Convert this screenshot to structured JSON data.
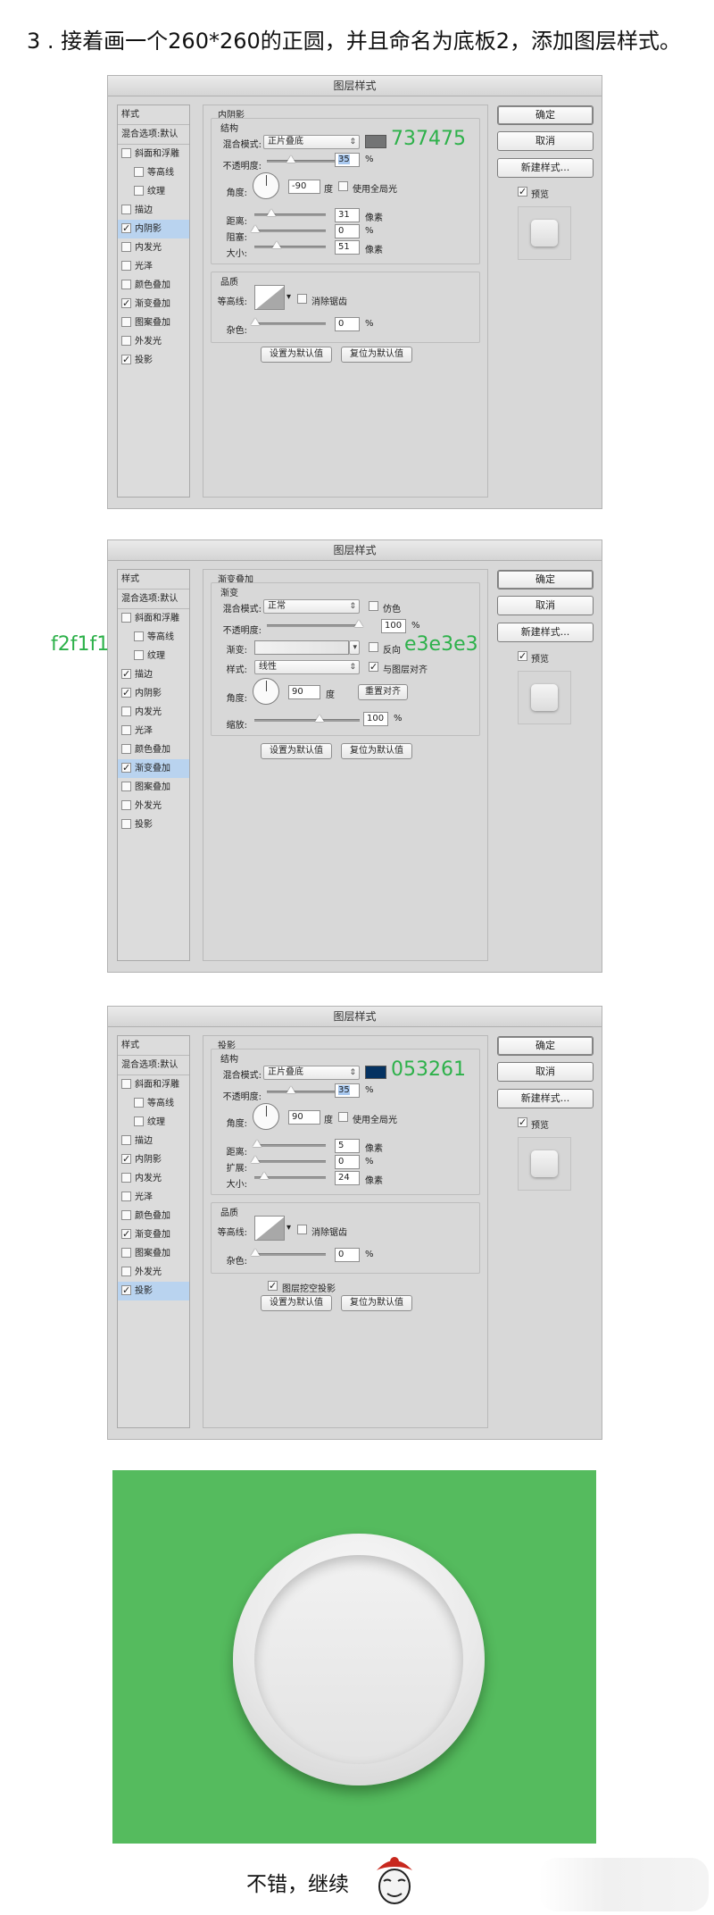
{
  "heading": "3 . 接着画一个260*260的正圆，并且命名为底板2，添加图层样式。",
  "colors": {
    "shadow_inner": "#737475",
    "shadow_drop": "#053261",
    "annotation": "#2db14a",
    "background_green": "#55bb5e"
  },
  "common": {
    "title": "图层样式",
    "left_head": "样式",
    "blend_default": "混合选项:默认",
    "left_items": [
      "斜面和浮雕",
      "等高线",
      "纹理",
      "描边",
      "内阴影",
      "内发光",
      "光泽",
      "颜色叠加",
      "渐变叠加",
      "图案叠加",
      "外发光",
      "投影"
    ],
    "ok": "确定",
    "cancel": "取消",
    "new_style": "新建样式...",
    "preview": "预览",
    "set_default": "设置为默认值",
    "reset_default": "复位为默认值"
  },
  "dialog1": {
    "section": "内阴影",
    "structure": "结构",
    "blend_mode_label": "混合模式:",
    "blend_mode": "正片叠底",
    "color_annotation": "737475",
    "opacity_label": "不透明度:",
    "opacity": "35",
    "percent": "%",
    "angle_label": "角度:",
    "angle": "-90",
    "degree": "度",
    "global_light": "使用全局光",
    "distance_label": "距离:",
    "distance": "31",
    "pixel": "像素",
    "choke_label": "阻塞:",
    "choke": "0",
    "size_label": "大小:",
    "size": "51",
    "quality": "品质",
    "contour_label": "等高线:",
    "antialias": "消除锯齿",
    "noise_label": "杂色:",
    "noise": "0"
  },
  "dialog2": {
    "section": "渐变叠加",
    "gradient_group": "渐变",
    "blend_mode_label": "混合模式:",
    "blend_mode": "正常",
    "dither": "仿色",
    "opacity_label": "不透明度:",
    "opacity": "100",
    "percent": "%",
    "gradient_label": "渐变:",
    "reverse": "反向",
    "style_label": "样式:",
    "style": "线性",
    "align_layer": "与图层对齐",
    "angle_label": "角度:",
    "angle": "90",
    "degree": "度",
    "reset_align": "重置对齐",
    "scale_label": "缩放:",
    "scale": "100",
    "anno_left": "f2f1f1",
    "anno_right": "e3e3e3"
  },
  "dialog3": {
    "section": "投影",
    "structure": "结构",
    "blend_mode_label": "混合模式:",
    "blend_mode": "正片叠底",
    "color_annotation": "053261",
    "opacity_label": "不透明度:",
    "opacity": "35",
    "percent": "%",
    "angle_label": "角度:",
    "angle": "90",
    "degree": "度",
    "global_light": "使用全局光",
    "distance_label": "距离:",
    "distance": "5",
    "pixel": "像素",
    "spread_label": "扩展:",
    "spread": "0",
    "size_label": "大小:",
    "size": "24",
    "quality": "品质",
    "contour_label": "等高线:",
    "antialias": "消除锯齿",
    "noise_label": "杂色:",
    "noise": "0",
    "knockout": "图层挖空投影"
  },
  "footer": "不错，继续"
}
